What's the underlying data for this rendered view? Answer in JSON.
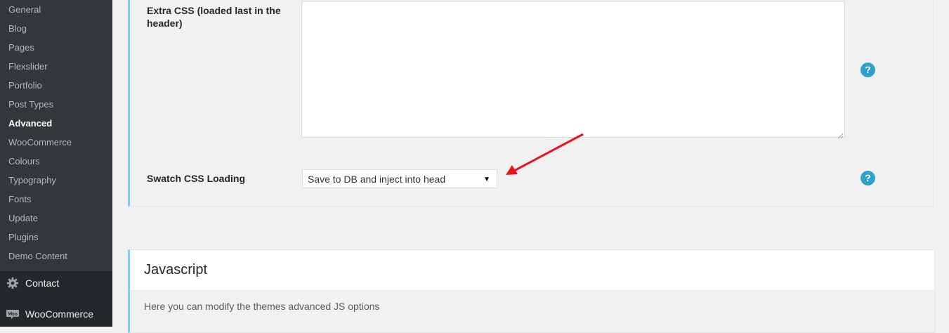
{
  "sidebar": {
    "submenu": [
      {
        "label": "General"
      },
      {
        "label": "Blog"
      },
      {
        "label": "Pages"
      },
      {
        "label": "Flexslider"
      },
      {
        "label": "Portfolio"
      },
      {
        "label": "Post Types"
      },
      {
        "label": "Advanced"
      },
      {
        "label": "WooCommerce"
      },
      {
        "label": "Colours"
      },
      {
        "label": "Typography"
      },
      {
        "label": "Fonts"
      },
      {
        "label": "Update"
      },
      {
        "label": "Plugins"
      },
      {
        "label": "Demo Content"
      }
    ],
    "active_item": "Advanced",
    "main_items": [
      {
        "label": "Contact",
        "icon": "gear-icon"
      },
      {
        "label": "WooCommerce",
        "icon": "woocommerce-icon"
      }
    ]
  },
  "settings": {
    "extra_css": {
      "label": "Extra CSS (loaded last in the header)",
      "value": ""
    },
    "swatch_css": {
      "label": "Swatch CSS Loading",
      "selected": "Save to DB and inject into head"
    },
    "help_glyph": "?"
  },
  "javascript_section": {
    "title": "Javascript",
    "description": "Here you can modify the themes advanced JS options"
  },
  "colors": {
    "sidebar_bg": "#32373c",
    "menu_bg": "#23282d",
    "accent_border": "#7ad0ee",
    "help_icon": "#2ea2cc",
    "annotation_arrow": "#e8141b"
  }
}
